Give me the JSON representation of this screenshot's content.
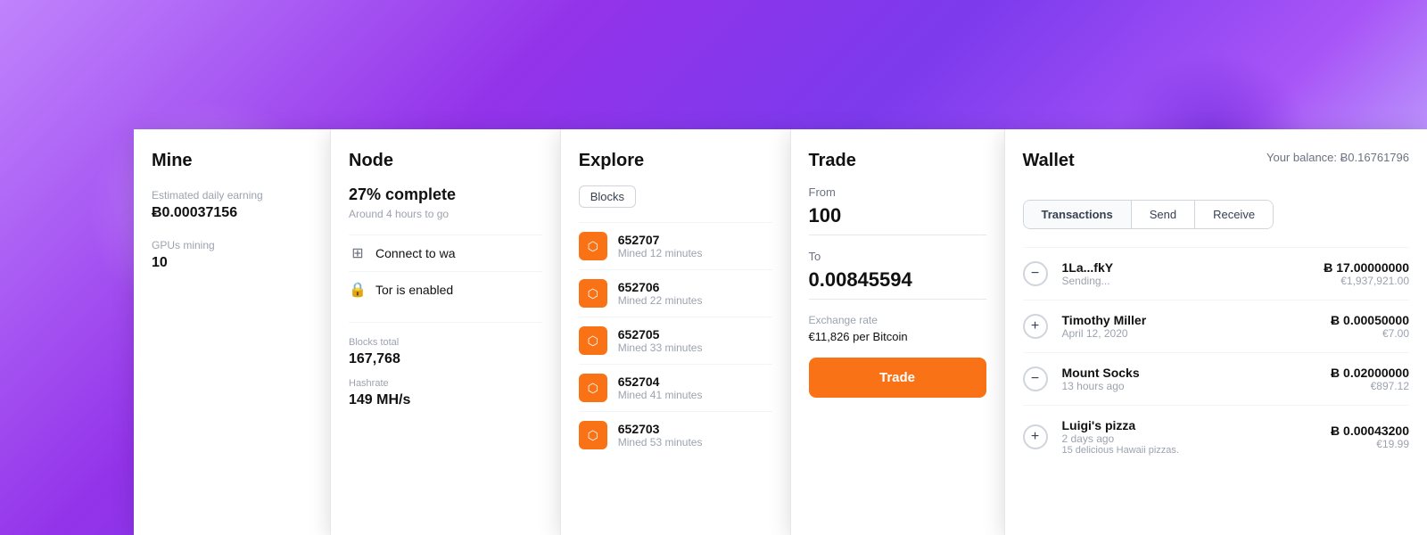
{
  "background": {
    "description": "Purple abstract paint texture background"
  },
  "panels": {
    "mine": {
      "title": "Mine",
      "stats": [
        {
          "label": "Estimated daily earning",
          "value": "Ƀ0.00037156"
        },
        {
          "label": "GPUs mining",
          "value": "10"
        }
      ]
    },
    "node": {
      "title": "Node",
      "progress": {
        "label": "27% complete",
        "sublabel": "Around 4 hours to go"
      },
      "items": [
        {
          "icon": "grid",
          "label": "Connect to wa"
        },
        {
          "icon": "lock",
          "label": "Tor is enabled"
        }
      ],
      "stats": [
        {
          "label": "Blocks total",
          "value": "167,768"
        },
        {
          "label": "Hashrate",
          "value": "149 MH/s"
        }
      ]
    },
    "explore": {
      "title": "Explore",
      "filter": "Blocks",
      "blocks": [
        {
          "number": "652707",
          "time": "Mined 12 minutes"
        },
        {
          "number": "652706",
          "time": "Mined 22 minutes"
        },
        {
          "number": "652705",
          "time": "Mined 33 minutes"
        },
        {
          "number": "652704",
          "time": "Mined 41 minutes"
        },
        {
          "number": "652703",
          "time": "Mined 53 minutes"
        }
      ]
    },
    "trade": {
      "title": "Trade",
      "from_label": "From",
      "from_value": "100",
      "to_label": "To",
      "to_value": "0.00845594",
      "exchange_rate_label": "Exchange rate",
      "exchange_rate_value": "€11,826 per Bitcoin",
      "button_label": "Trade"
    },
    "wallet": {
      "title": "Wallet",
      "balance_label": "Your balance:",
      "balance_value": "Ƀ0.16761796",
      "tabs": [
        "Transactions",
        "Send",
        "Receive"
      ],
      "active_tab": "Transactions",
      "transactions": [
        {
          "sign": "−",
          "sign_type": "minus",
          "name": "1La...fkY",
          "sub": "Sending...",
          "btc": "Ƀ 17.00000000",
          "eur": "€1,937,921.00"
        },
        {
          "sign": "+",
          "sign_type": "plus",
          "name": "Timothy Miller",
          "sub": "April 12, 2020",
          "btc": "Ƀ 0.00050000",
          "eur": "€7.00"
        },
        {
          "sign": "−",
          "sign_type": "minus",
          "name": "Mount Socks",
          "sub": "13 hours ago",
          "btc": "Ƀ 0.02000000",
          "eur": "€897.12"
        },
        {
          "sign": "+",
          "sign_type": "plus",
          "name": "Luigi's pizza",
          "sub": "2 days ago",
          "note": "15 delicious Hawaii pizzas.",
          "btc": "Ƀ 0.00043200",
          "eur": "€19.99"
        }
      ]
    }
  }
}
